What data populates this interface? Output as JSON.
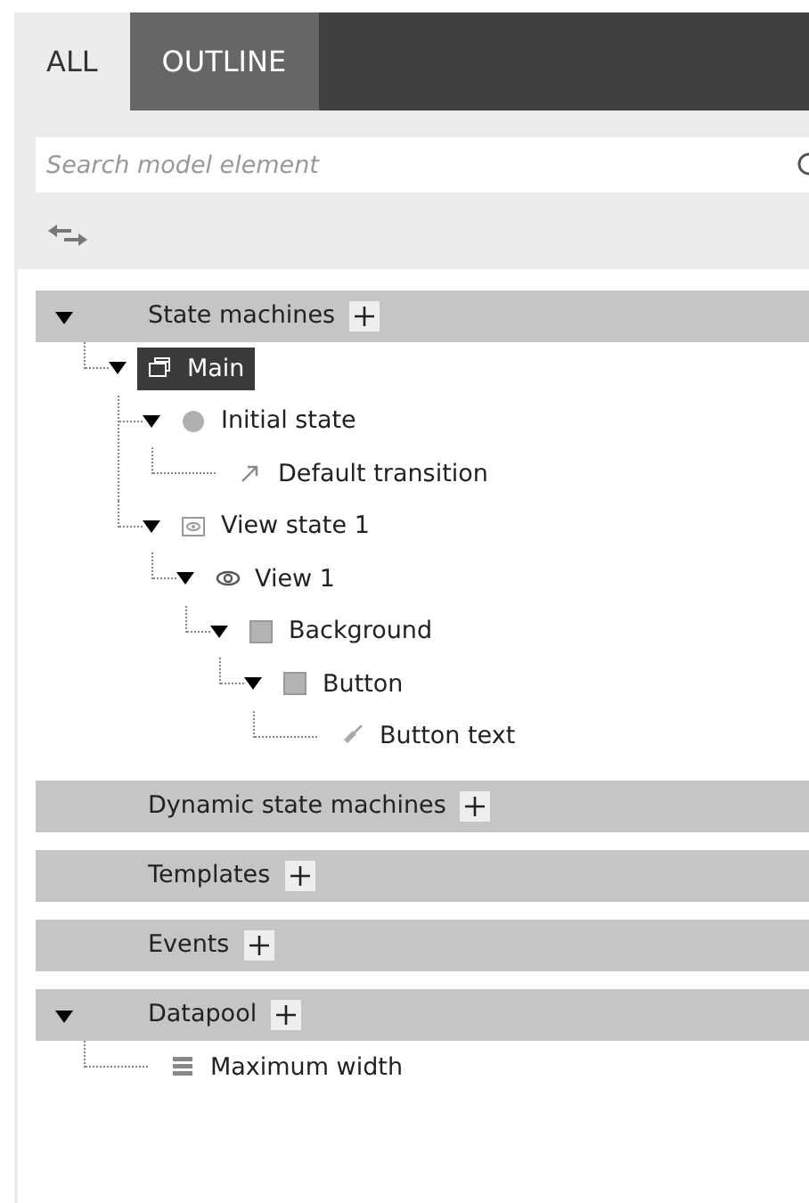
{
  "tabs": [
    {
      "label": "ALL",
      "selected": true
    },
    {
      "label": "OUTLINE",
      "selected": false
    }
  ],
  "search": {
    "placeholder": "Search model element"
  },
  "sections": [
    {
      "label": "State machines",
      "expanded": true,
      "children": [
        {
          "label": "Main",
          "kind": "window",
          "selected": true,
          "expanded": true,
          "children": [
            {
              "label": "Initial state",
              "kind": "circle",
              "selected": false,
              "expanded": true,
              "children": [
                {
                  "label": "Default transition",
                  "kind": "arrow",
                  "selected": false,
                  "expanded": false
                }
              ]
            },
            {
              "label": "View state 1",
              "kind": "viewstate",
              "selected": false,
              "expanded": true,
              "children": [
                {
                  "label": "View 1",
                  "kind": "eye",
                  "selected": false,
                  "expanded": true,
                  "children": [
                    {
                      "label": "Background",
                      "kind": "square",
                      "selected": false,
                      "expanded": true,
                      "children": [
                        {
                          "label": "Button",
                          "kind": "square",
                          "selected": false,
                          "expanded": true,
                          "children": [
                            {
                              "label": "Button text",
                              "kind": "tag",
                              "selected": false,
                              "expanded": false
                            }
                          ]
                        }
                      ]
                    }
                  ]
                }
              ]
            }
          ]
        }
      ]
    },
    {
      "label": "Dynamic state machines",
      "expanded": false
    },
    {
      "label": "Templates",
      "expanded": false
    },
    {
      "label": "Events",
      "expanded": false
    },
    {
      "label": "Datapool",
      "expanded": true,
      "children": [
        {
          "label": "Maximum width",
          "kind": "list",
          "selected": false,
          "expanded": false
        }
      ]
    }
  ]
}
